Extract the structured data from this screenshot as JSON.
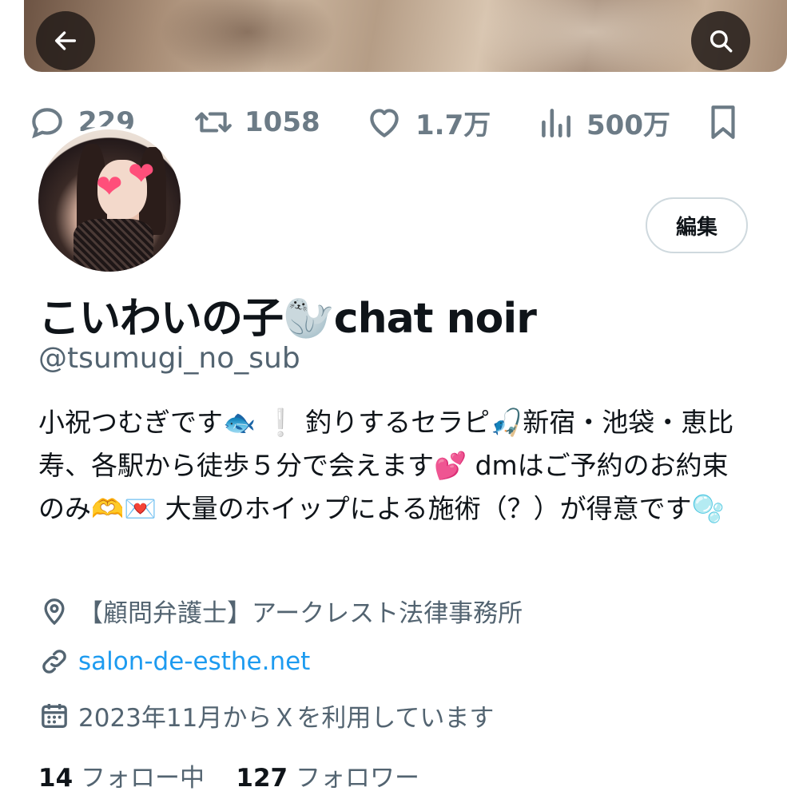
{
  "header": {
    "back_icon": "arrow-left-icon",
    "search_icon": "search-icon"
  },
  "post_actions": {
    "replies": "229",
    "reposts": "1058",
    "likes": "1.7万",
    "views": "500万"
  },
  "profile": {
    "display_name": "こいわいの子🦭chat noir",
    "handle": "@tsumugi_no_sub",
    "edit_button": "編集",
    "bio": "小祝つむぎです🐟 ❕ 釣りするセラピ🎣新宿・池袋・恵比寿、各駅から徒歩５分で会えます💕 dmはご予約のお約束のみ🫶💌 大量のホイップによる施術（？）が得意です🫧",
    "location": "【顧問弁護士】アークレスト法律事務所",
    "website": "salon-de-esthe.net",
    "joined": "2023年11月からＸを利用しています",
    "following_count": "14",
    "following_label": "フォロー中",
    "followers_count": "127",
    "followers_label": "フォロワー"
  },
  "colors": {
    "text": "#0f1419",
    "secondary": "#536471",
    "link": "#1d9bf0",
    "border": "#cfd9de"
  }
}
